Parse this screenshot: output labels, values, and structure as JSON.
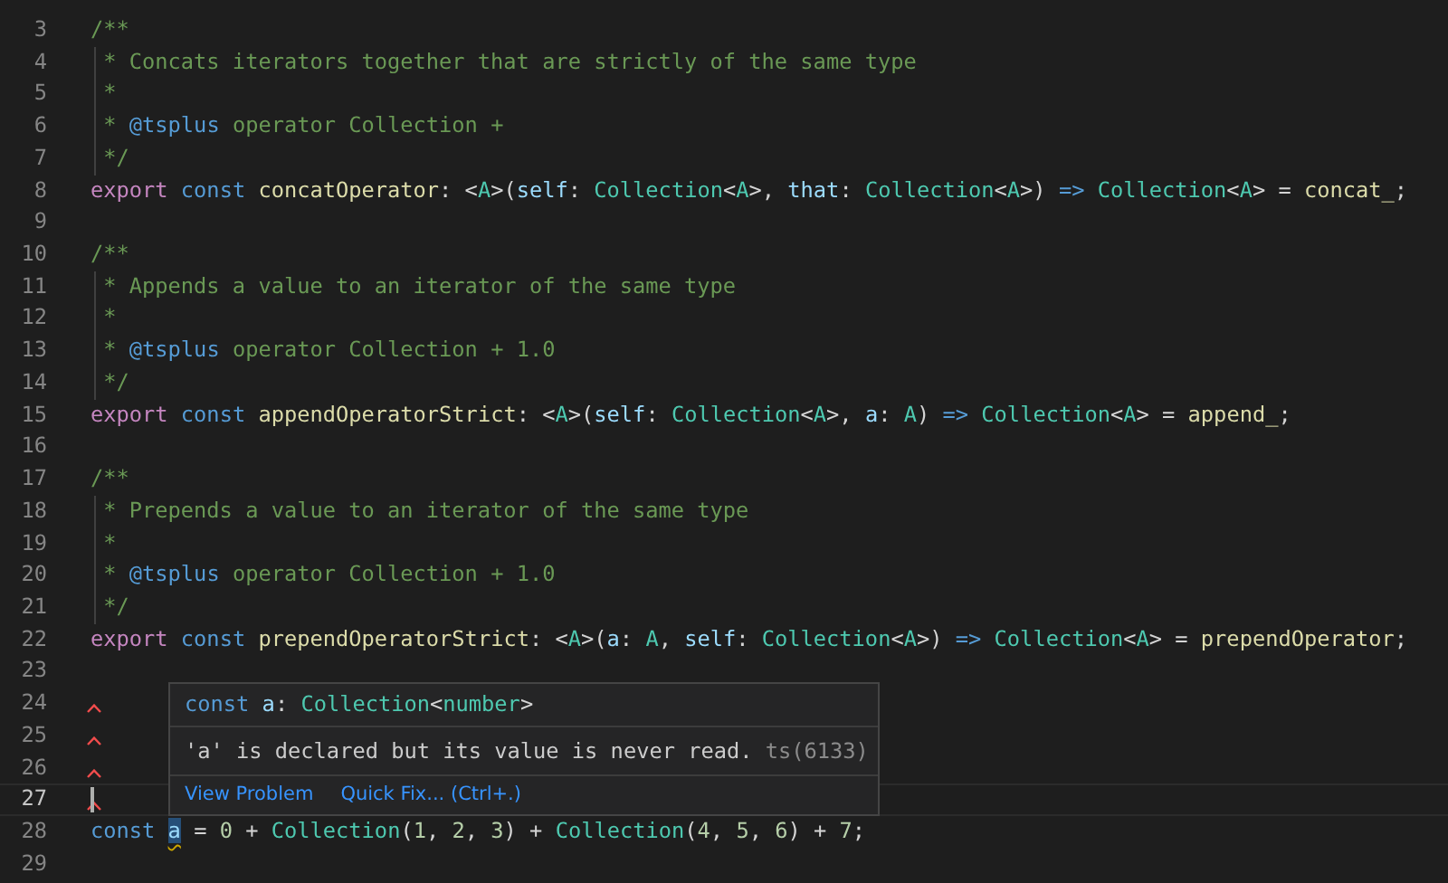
{
  "editor": {
    "lines": [
      {
        "number": "3",
        "tokens": [
          {
            "kind": "comment",
            "text": "/**"
          }
        ]
      },
      {
        "number": "4",
        "guide": true,
        "tokens": [
          {
            "kind": "comment",
            "text": " * Concats iterators together that are strictly of the same type"
          }
        ]
      },
      {
        "number": "5",
        "guide": true,
        "tokens": [
          {
            "kind": "comment",
            "text": " *"
          }
        ]
      },
      {
        "number": "6",
        "guide": true,
        "tokens": [
          {
            "kind": "comment",
            "text": " * "
          },
          {
            "kind": "tag",
            "text": "@tsplus"
          },
          {
            "kind": "comment",
            "text": " operator Collection +"
          }
        ]
      },
      {
        "number": "7",
        "guide": true,
        "tokens": [
          {
            "kind": "comment",
            "text": " */"
          }
        ]
      },
      {
        "number": "8",
        "tokens": [
          {
            "kind": "control",
            "text": "export "
          },
          {
            "kind": "keyword",
            "text": "const "
          },
          {
            "kind": "function",
            "text": "concatOperator"
          },
          {
            "kind": "plain",
            "text": ": <"
          },
          {
            "kind": "type",
            "text": "A"
          },
          {
            "kind": "plain",
            "text": ">("
          },
          {
            "kind": "param",
            "text": "self"
          },
          {
            "kind": "plain",
            "text": ": "
          },
          {
            "kind": "type",
            "text": "Collection"
          },
          {
            "kind": "plain",
            "text": "<"
          },
          {
            "kind": "type",
            "text": "A"
          },
          {
            "kind": "plain",
            "text": ">, "
          },
          {
            "kind": "param",
            "text": "that"
          },
          {
            "kind": "plain",
            "text": ": "
          },
          {
            "kind": "type",
            "text": "Collection"
          },
          {
            "kind": "plain",
            "text": "<"
          },
          {
            "kind": "type",
            "text": "A"
          },
          {
            "kind": "plain",
            "text": ">) "
          },
          {
            "kind": "keyword",
            "text": "=> "
          },
          {
            "kind": "type",
            "text": "Collection"
          },
          {
            "kind": "plain",
            "text": "<"
          },
          {
            "kind": "type",
            "text": "A"
          },
          {
            "kind": "plain",
            "text": "> = "
          },
          {
            "kind": "function",
            "text": "concat_"
          },
          {
            "kind": "plain",
            "text": ";"
          }
        ]
      },
      {
        "number": "9"
      },
      {
        "number": "10",
        "tokens": [
          {
            "kind": "comment",
            "text": "/**"
          }
        ]
      },
      {
        "number": "11",
        "guide": true,
        "tokens": [
          {
            "kind": "comment",
            "text": " * Appends a value to an iterator of the same type"
          }
        ]
      },
      {
        "number": "12",
        "guide": true,
        "tokens": [
          {
            "kind": "comment",
            "text": " *"
          }
        ]
      },
      {
        "number": "13",
        "guide": true,
        "tokens": [
          {
            "kind": "comment",
            "text": " * "
          },
          {
            "kind": "tag",
            "text": "@tsplus"
          },
          {
            "kind": "comment",
            "text": " operator Collection + 1.0"
          }
        ]
      },
      {
        "number": "14",
        "guide": true,
        "tokens": [
          {
            "kind": "comment",
            "text": " */"
          }
        ]
      },
      {
        "number": "15",
        "tokens": [
          {
            "kind": "control",
            "text": "export "
          },
          {
            "kind": "keyword",
            "text": "const "
          },
          {
            "kind": "function",
            "text": "appendOperatorStrict"
          },
          {
            "kind": "plain",
            "text": ": <"
          },
          {
            "kind": "type",
            "text": "A"
          },
          {
            "kind": "plain",
            "text": ">("
          },
          {
            "kind": "param",
            "text": "self"
          },
          {
            "kind": "plain",
            "text": ": "
          },
          {
            "kind": "type",
            "text": "Collection"
          },
          {
            "kind": "plain",
            "text": "<"
          },
          {
            "kind": "type",
            "text": "A"
          },
          {
            "kind": "plain",
            "text": ">, "
          },
          {
            "kind": "param",
            "text": "a"
          },
          {
            "kind": "plain",
            "text": ": "
          },
          {
            "kind": "type",
            "text": "A"
          },
          {
            "kind": "plain",
            "text": ") "
          },
          {
            "kind": "keyword",
            "text": "=> "
          },
          {
            "kind": "type",
            "text": "Collection"
          },
          {
            "kind": "plain",
            "text": "<"
          },
          {
            "kind": "type",
            "text": "A"
          },
          {
            "kind": "plain",
            "text": "> = "
          },
          {
            "kind": "function",
            "text": "append_"
          },
          {
            "kind": "plain",
            "text": ";"
          }
        ]
      },
      {
        "number": "16"
      },
      {
        "number": "17",
        "tokens": [
          {
            "kind": "comment",
            "text": "/**"
          }
        ]
      },
      {
        "number": "18",
        "guide": true,
        "tokens": [
          {
            "kind": "comment",
            "text": " * Prepends a value to an iterator of the same type"
          }
        ]
      },
      {
        "number": "19",
        "guide": true,
        "tokens": [
          {
            "kind": "comment",
            "text": " *"
          }
        ]
      },
      {
        "number": "20",
        "guide": true,
        "tokens": [
          {
            "kind": "comment",
            "text": " * "
          },
          {
            "kind": "tag",
            "text": "@tsplus"
          },
          {
            "kind": "comment",
            "text": " operator Collection + 1.0"
          }
        ]
      },
      {
        "number": "21",
        "guide": true,
        "tokens": [
          {
            "kind": "comment",
            "text": " */"
          }
        ]
      },
      {
        "number": "22",
        "tokens": [
          {
            "kind": "control",
            "text": "export "
          },
          {
            "kind": "keyword",
            "text": "const "
          },
          {
            "kind": "function",
            "text": "prependOperatorStrict"
          },
          {
            "kind": "plain",
            "text": ": <"
          },
          {
            "kind": "type",
            "text": "A"
          },
          {
            "kind": "plain",
            "text": ">("
          },
          {
            "kind": "param",
            "text": "a"
          },
          {
            "kind": "plain",
            "text": ": "
          },
          {
            "kind": "type",
            "text": "A"
          },
          {
            "kind": "plain",
            "text": ", "
          },
          {
            "kind": "param",
            "text": "self"
          },
          {
            "kind": "plain",
            "text": ": "
          },
          {
            "kind": "type",
            "text": "Collection"
          },
          {
            "kind": "plain",
            "text": "<"
          },
          {
            "kind": "type",
            "text": "A"
          },
          {
            "kind": "plain",
            "text": ">) "
          },
          {
            "kind": "keyword",
            "text": "=> "
          },
          {
            "kind": "type",
            "text": "Collection"
          },
          {
            "kind": "plain",
            "text": "<"
          },
          {
            "kind": "type",
            "text": "A"
          },
          {
            "kind": "plain",
            "text": "> = "
          },
          {
            "kind": "function",
            "text": "prependOperator"
          },
          {
            "kind": "plain",
            "text": ";"
          }
        ]
      },
      {
        "number": "23"
      },
      {
        "number": "24",
        "error_marker": true
      },
      {
        "number": "25",
        "error_marker": true
      },
      {
        "number": "26",
        "error_marker": true
      },
      {
        "number": "27",
        "current": true,
        "cursor": true,
        "error_marker": true
      },
      {
        "number": "28",
        "tokens": [
          {
            "kind": "keyword",
            "text": "const "
          },
          {
            "kind": "param",
            "text": "a",
            "warning": true
          },
          {
            "kind": "plain",
            "text": " = "
          },
          {
            "kind": "number",
            "text": "0"
          },
          {
            "kind": "plain",
            "text": " + "
          },
          {
            "kind": "type",
            "text": "Collection"
          },
          {
            "kind": "plain",
            "text": "("
          },
          {
            "kind": "number",
            "text": "1"
          },
          {
            "kind": "plain",
            "text": ", "
          },
          {
            "kind": "number",
            "text": "2"
          },
          {
            "kind": "plain",
            "text": ", "
          },
          {
            "kind": "number",
            "text": "3"
          },
          {
            "kind": "plain",
            "text": ") + "
          },
          {
            "kind": "type",
            "text": "Collection"
          },
          {
            "kind": "plain",
            "text": "("
          },
          {
            "kind": "number",
            "text": "4"
          },
          {
            "kind": "plain",
            "text": ", "
          },
          {
            "kind": "number",
            "text": "5"
          },
          {
            "kind": "plain",
            "text": ", "
          },
          {
            "kind": "number",
            "text": "6"
          },
          {
            "kind": "plain",
            "text": ") + "
          },
          {
            "kind": "number",
            "text": "7"
          },
          {
            "kind": "plain",
            "text": ";"
          }
        ]
      },
      {
        "number": "29"
      }
    ]
  },
  "hover": {
    "signature": [
      {
        "kind": "keyword",
        "text": "const "
      },
      {
        "kind": "param",
        "text": "a"
      },
      {
        "kind": "plain",
        "text": ": "
      },
      {
        "kind": "type",
        "text": "Collection"
      },
      {
        "kind": "plain",
        "text": "<"
      },
      {
        "kind": "type",
        "text": "number"
      },
      {
        "kind": "plain",
        "text": ">"
      }
    ],
    "message": "'a' is declared but its value is never read.",
    "code": "ts(6133)",
    "actions": [
      {
        "label": "View Problem"
      },
      {
        "label": "Quick Fix... (Ctrl+.)"
      }
    ]
  }
}
